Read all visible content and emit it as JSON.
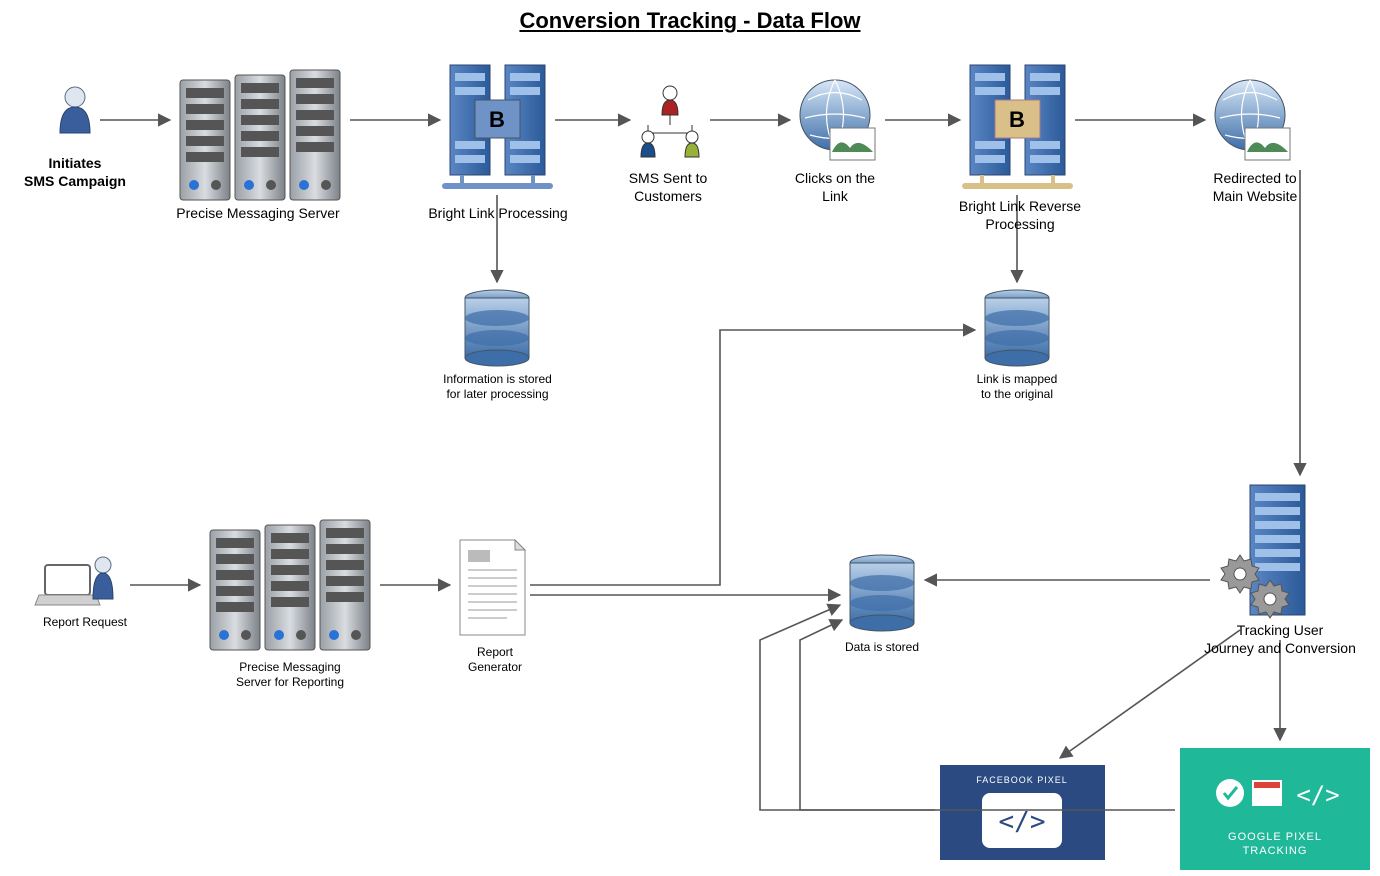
{
  "title": "Conversion Tracking - Data Flow",
  "nodes": {
    "initiates": "Initiates\nSMS Campaign",
    "messaging_server": "Precise Messaging Server",
    "bright_link": "Bright Link Processing",
    "bright_link_badge": "B",
    "info_stored": "Information is stored\nfor later processing",
    "sms_sent": "SMS Sent to\nCustomers",
    "clicks_link": "Clicks on the\nLink",
    "reverse_proc": "Bright Link Reverse\nProcessing",
    "reverse_badge": "B",
    "redirected": "Redirected to\nMain Website",
    "link_mapped": "Link is mapped\nto the original",
    "report_request": "Report Request",
    "reporting_server": "Precise Messaging\nServer for Reporting",
    "report_generator": "Report\nGenerator",
    "data_stored": "Data is stored",
    "tracking": "Tracking User\nJourney and Conversion",
    "facebook_pixel": "FACEBOOK PIXEL",
    "google_pixel": "GOOGLE PIXEL\nTRACKING"
  }
}
